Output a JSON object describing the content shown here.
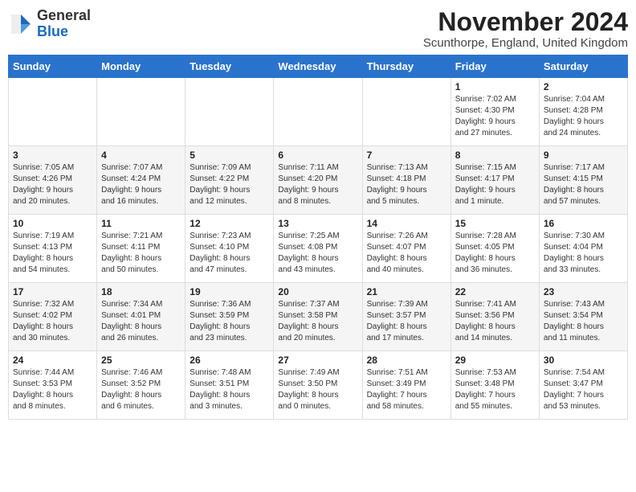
{
  "logo": {
    "general": "General",
    "blue": "Blue"
  },
  "header": {
    "month": "November 2024",
    "location": "Scunthorpe, England, United Kingdom"
  },
  "days_of_week": [
    "Sunday",
    "Monday",
    "Tuesday",
    "Wednesday",
    "Thursday",
    "Friday",
    "Saturday"
  ],
  "weeks": [
    [
      {
        "day": "",
        "info": ""
      },
      {
        "day": "",
        "info": ""
      },
      {
        "day": "",
        "info": ""
      },
      {
        "day": "",
        "info": ""
      },
      {
        "day": "",
        "info": ""
      },
      {
        "day": "1",
        "info": "Sunrise: 7:02 AM\nSunset: 4:30 PM\nDaylight: 9 hours\nand 27 minutes."
      },
      {
        "day": "2",
        "info": "Sunrise: 7:04 AM\nSunset: 4:28 PM\nDaylight: 9 hours\nand 24 minutes."
      }
    ],
    [
      {
        "day": "3",
        "info": "Sunrise: 7:05 AM\nSunset: 4:26 PM\nDaylight: 9 hours\nand 20 minutes."
      },
      {
        "day": "4",
        "info": "Sunrise: 7:07 AM\nSunset: 4:24 PM\nDaylight: 9 hours\nand 16 minutes."
      },
      {
        "day": "5",
        "info": "Sunrise: 7:09 AM\nSunset: 4:22 PM\nDaylight: 9 hours\nand 12 minutes."
      },
      {
        "day": "6",
        "info": "Sunrise: 7:11 AM\nSunset: 4:20 PM\nDaylight: 9 hours\nand 8 minutes."
      },
      {
        "day": "7",
        "info": "Sunrise: 7:13 AM\nSunset: 4:18 PM\nDaylight: 9 hours\nand 5 minutes."
      },
      {
        "day": "8",
        "info": "Sunrise: 7:15 AM\nSunset: 4:17 PM\nDaylight: 9 hours\nand 1 minute."
      },
      {
        "day": "9",
        "info": "Sunrise: 7:17 AM\nSunset: 4:15 PM\nDaylight: 8 hours\nand 57 minutes."
      }
    ],
    [
      {
        "day": "10",
        "info": "Sunrise: 7:19 AM\nSunset: 4:13 PM\nDaylight: 8 hours\nand 54 minutes."
      },
      {
        "day": "11",
        "info": "Sunrise: 7:21 AM\nSunset: 4:11 PM\nDaylight: 8 hours\nand 50 minutes."
      },
      {
        "day": "12",
        "info": "Sunrise: 7:23 AM\nSunset: 4:10 PM\nDaylight: 8 hours\nand 47 minutes."
      },
      {
        "day": "13",
        "info": "Sunrise: 7:25 AM\nSunset: 4:08 PM\nDaylight: 8 hours\nand 43 minutes."
      },
      {
        "day": "14",
        "info": "Sunrise: 7:26 AM\nSunset: 4:07 PM\nDaylight: 8 hours\nand 40 minutes."
      },
      {
        "day": "15",
        "info": "Sunrise: 7:28 AM\nSunset: 4:05 PM\nDaylight: 8 hours\nand 36 minutes."
      },
      {
        "day": "16",
        "info": "Sunrise: 7:30 AM\nSunset: 4:04 PM\nDaylight: 8 hours\nand 33 minutes."
      }
    ],
    [
      {
        "day": "17",
        "info": "Sunrise: 7:32 AM\nSunset: 4:02 PM\nDaylight: 8 hours\nand 30 minutes."
      },
      {
        "day": "18",
        "info": "Sunrise: 7:34 AM\nSunset: 4:01 PM\nDaylight: 8 hours\nand 26 minutes."
      },
      {
        "day": "19",
        "info": "Sunrise: 7:36 AM\nSunset: 3:59 PM\nDaylight: 8 hours\nand 23 minutes."
      },
      {
        "day": "20",
        "info": "Sunrise: 7:37 AM\nSunset: 3:58 PM\nDaylight: 8 hours\nand 20 minutes."
      },
      {
        "day": "21",
        "info": "Sunrise: 7:39 AM\nSunset: 3:57 PM\nDaylight: 8 hours\nand 17 minutes."
      },
      {
        "day": "22",
        "info": "Sunrise: 7:41 AM\nSunset: 3:56 PM\nDaylight: 8 hours\nand 14 minutes."
      },
      {
        "day": "23",
        "info": "Sunrise: 7:43 AM\nSunset: 3:54 PM\nDaylight: 8 hours\nand 11 minutes."
      }
    ],
    [
      {
        "day": "24",
        "info": "Sunrise: 7:44 AM\nSunset: 3:53 PM\nDaylight: 8 hours\nand 8 minutes."
      },
      {
        "day": "25",
        "info": "Sunrise: 7:46 AM\nSunset: 3:52 PM\nDaylight: 8 hours\nand 6 minutes."
      },
      {
        "day": "26",
        "info": "Sunrise: 7:48 AM\nSunset: 3:51 PM\nDaylight: 8 hours\nand 3 minutes."
      },
      {
        "day": "27",
        "info": "Sunrise: 7:49 AM\nSunset: 3:50 PM\nDaylight: 8 hours\nand 0 minutes."
      },
      {
        "day": "28",
        "info": "Sunrise: 7:51 AM\nSunset: 3:49 PM\nDaylight: 7 hours\nand 58 minutes."
      },
      {
        "day": "29",
        "info": "Sunrise: 7:53 AM\nSunset: 3:48 PM\nDaylight: 7 hours\nand 55 minutes."
      },
      {
        "day": "30",
        "info": "Sunrise: 7:54 AM\nSunset: 3:47 PM\nDaylight: 7 hours\nand 53 minutes."
      }
    ]
  ]
}
